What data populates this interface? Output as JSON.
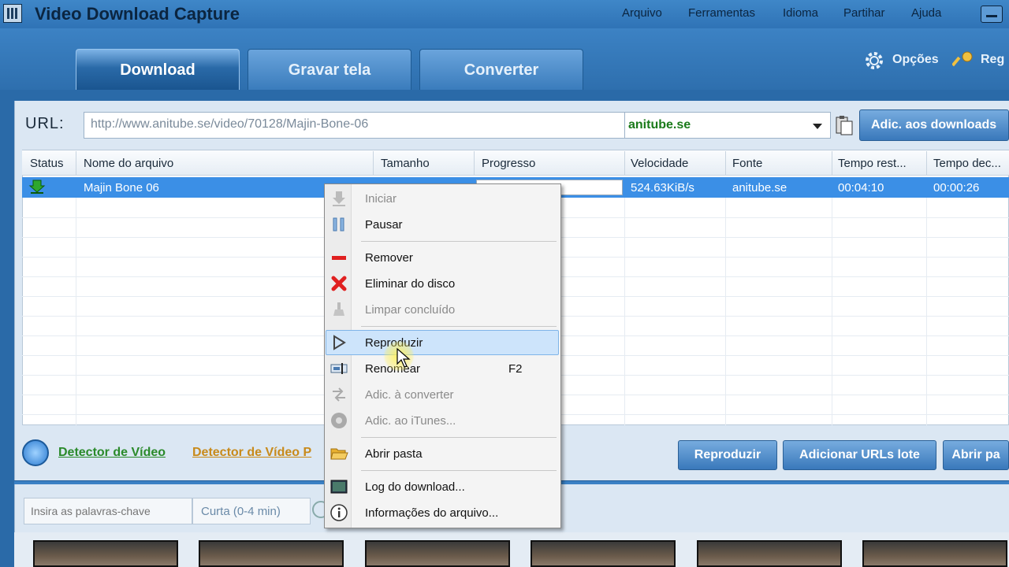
{
  "app": {
    "title": "Video Download Capture"
  },
  "menu": [
    "Arquivo",
    "Ferramentas",
    "Idioma",
    "Partihar",
    "Ajuda"
  ],
  "tabs": [
    "Download",
    "Gravar tela",
    "Converter"
  ],
  "right_actions": {
    "options": "Opções",
    "register": "Reg"
  },
  "url_bar": {
    "label": "URL:",
    "value": "http://www.anitube.se/video/70128/Majin-Bone-06",
    "site": "anitube.se",
    "add_button": "Adic. aos downloads"
  },
  "table": {
    "columns": [
      "Status",
      "Nome do arquivo",
      "Tamanho",
      "Progresso",
      "Velocidade",
      "Fonte",
      "Tempo rest...",
      "Tempo dec..."
    ],
    "rows": [
      {
        "name": "Majin Bone 06",
        "speed": "524.63KiB/s",
        "source": "anitube.se",
        "remaining": "00:04:10",
        "elapsed": "00:00:26"
      }
    ]
  },
  "context_menu": [
    {
      "label": "Iniciar",
      "icon": "download-arrow-icon",
      "disabled": true
    },
    {
      "label": "Pausar",
      "icon": "pause-icon",
      "disabled": false
    },
    {
      "label": "Remover",
      "icon": "minus-icon",
      "disabled": false
    },
    {
      "label": "Eliminar do disco",
      "icon": "red-x-icon",
      "disabled": false
    },
    {
      "label": "Limpar concluído",
      "icon": "broom-icon",
      "disabled": true
    },
    {
      "label": "Reproduzir",
      "icon": "play-icon",
      "disabled": false,
      "highlighted": true
    },
    {
      "label": "Renomear",
      "icon": "rename-icon",
      "disabled": false,
      "shortcut": "F2"
    },
    {
      "label": "Adic. à converter",
      "icon": "convert-arrows-icon",
      "disabled": true
    },
    {
      "label": "Adic. ao iTunes...",
      "icon": "itunes-icon",
      "disabled": true
    },
    {
      "label": "Abrir pasta",
      "icon": "folder-icon",
      "disabled": false
    },
    {
      "label": "Log do download...",
      "icon": "log-icon",
      "disabled": false
    },
    {
      "label": "Informações do arquivo...",
      "icon": "info-icon",
      "disabled": false
    }
  ],
  "detectors": {
    "video": "Detector de Vídeo",
    "video_pro": "Detector de Vídeo P"
  },
  "bottom_buttons": [
    "Reproduzir",
    "Adicionar URLs lote",
    "Abrir pa"
  ],
  "search": {
    "placeholder": "Insira as palavras-chave",
    "duration": "Curta (0-4 min)"
  },
  "colors": {
    "accent": "#2a6aa8",
    "selected_row": "#3b8fe6",
    "site_green": "#1a7a1a"
  }
}
